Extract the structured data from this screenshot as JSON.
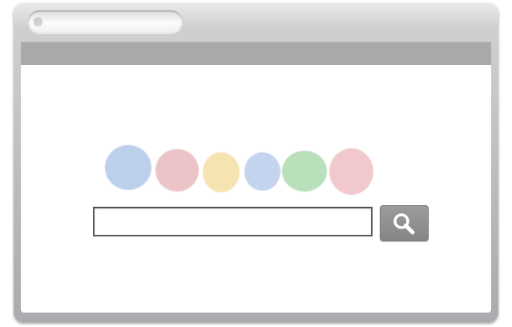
{
  "window": {
    "address_bar_text": "",
    "frame_color": "#b8babd",
    "toolbar_color": "#a9a9a9"
  },
  "logo": {
    "dots": [
      {
        "color": "#bcd0ec"
      },
      {
        "color": "#ecc4c7"
      },
      {
        "color": "#f6e3b2"
      },
      {
        "color": "#c4d4ef"
      },
      {
        "color": "#b9e0bb"
      },
      {
        "color": "#f1c9cd"
      }
    ]
  },
  "search": {
    "value": "",
    "placeholder": "",
    "button_icon": "magnifier-icon",
    "button_color": "#909090"
  }
}
